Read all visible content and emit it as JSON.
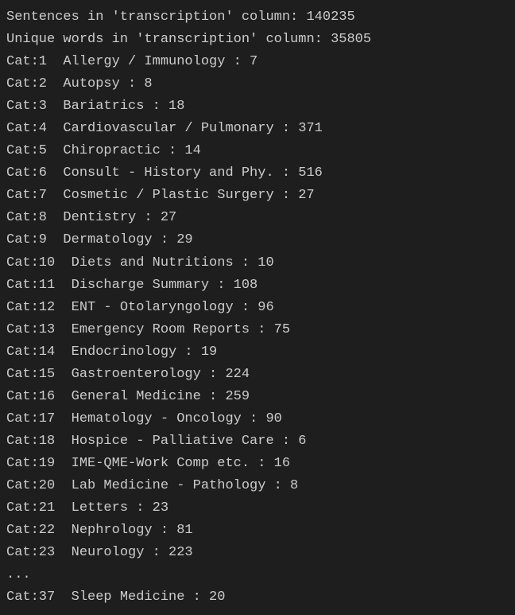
{
  "header": {
    "sentences_label": "Sentences in 'transcription' column:",
    "sentences_count": "140235",
    "unique_words_label": "Unique words in 'transcription' column:",
    "unique_words_count": "35805"
  },
  "categories": [
    {
      "prefix": "Cat:1",
      "name": "Allergy / Immunology",
      "count": "7"
    },
    {
      "prefix": "Cat:2",
      "name": "Autopsy",
      "count": "8"
    },
    {
      "prefix": "Cat:3",
      "name": "Bariatrics",
      "count": "18"
    },
    {
      "prefix": "Cat:4",
      "name": "Cardiovascular / Pulmonary",
      "count": "371"
    },
    {
      "prefix": "Cat:5",
      "name": "Chiropractic",
      "count": "14"
    },
    {
      "prefix": "Cat:6",
      "name": "Consult - History and Phy.",
      "count": "516"
    },
    {
      "prefix": "Cat:7",
      "name": "Cosmetic / Plastic Surgery",
      "count": "27"
    },
    {
      "prefix": "Cat:8",
      "name": "Dentistry",
      "count": "27"
    },
    {
      "prefix": "Cat:9",
      "name": "Dermatology",
      "count": "29"
    },
    {
      "prefix": "Cat:10",
      "name": "Diets and Nutritions",
      "count": "10"
    },
    {
      "prefix": "Cat:11",
      "name": "Discharge Summary",
      "count": "108"
    },
    {
      "prefix": "Cat:12",
      "name": "ENT - Otolaryngology",
      "count": "96"
    },
    {
      "prefix": "Cat:13",
      "name": "Emergency Room Reports",
      "count": "75"
    },
    {
      "prefix": "Cat:14",
      "name": "Endocrinology",
      "count": "19"
    },
    {
      "prefix": "Cat:15",
      "name": "Gastroenterology",
      "count": "224"
    },
    {
      "prefix": "Cat:16",
      "name": "General Medicine",
      "count": "259"
    },
    {
      "prefix": "Cat:17",
      "name": "Hematology - Oncology",
      "count": "90"
    },
    {
      "prefix": "Cat:18",
      "name": "Hospice - Palliative Care",
      "count": "6"
    },
    {
      "prefix": "Cat:19",
      "name": "IME-QME-Work Comp etc.",
      "count": "16"
    },
    {
      "prefix": "Cat:20",
      "name": "Lab Medicine - Pathology",
      "count": "8"
    },
    {
      "prefix": "Cat:21",
      "name": "Letters",
      "count": "23"
    },
    {
      "prefix": "Cat:22",
      "name": "Nephrology",
      "count": "81"
    },
    {
      "prefix": "Cat:23",
      "name": "Neurology",
      "count": "223"
    }
  ],
  "ellipsis": "...",
  "tail": [
    {
      "prefix": "Cat:37",
      "name": "Sleep Medicine",
      "count": "20"
    }
  ]
}
